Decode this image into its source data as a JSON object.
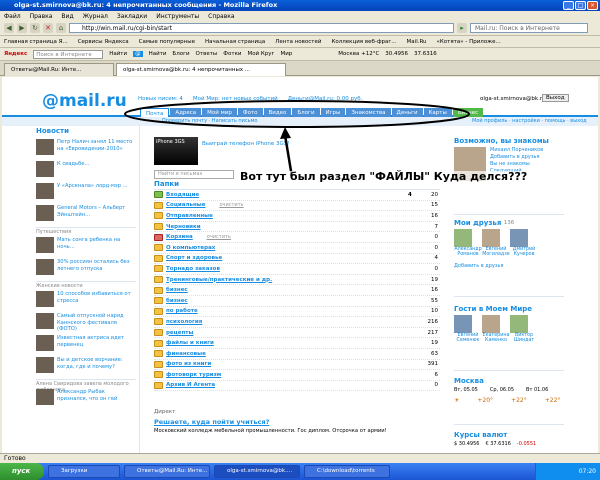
{
  "window": {
    "title": "olga-st.smirnova@bk.ru: 4 непрочитанных сообщения - Mozilla Firefox"
  },
  "menu": [
    "Файл",
    "Правка",
    "Вид",
    "Журнал",
    "Закладки",
    "Инструменты",
    "Справка"
  ],
  "address": {
    "url": "http://win.mail.ru/cgi-bin/start",
    "search_placeholder": "Mail.ru: Поиск в Интернете"
  },
  "bookmarks": [
    "Главная страница Я...",
    "Сервисы Яндекса",
    "Самые популярные",
    "Начальная страница",
    "Лента новостей",
    "Коллекция веб-фраг...",
    "Mail.Ru",
    "«Котята» - Приложе..."
  ],
  "yandex_bar": {
    "search_placeholder": "Поиск в Интернете",
    "find": "Найти",
    "items": [
      "Блоги",
      "Ответы",
      "Знакомства",
      "Афиша",
      "Авто"
    ],
    "info": "Москва +13",
    "usd": "USD 30,58",
    "eur": "EUR 43,57"
  },
  "mailru_bar": {
    "find": "Найти",
    "items": [
      "Блоги",
      "Ответы",
      "Фотки",
      "Мой Круг",
      "Мир"
    ],
    "weather": "Москва +12°С",
    "rate1": "30.4956",
    "rate2": "37.6316"
  },
  "tabs": [
    "Ответы@Mail.Ru: Инте...",
    "olga-st.smirnova@bk.ru: 4 непрочитанных ..."
  ],
  "page": {
    "logo": "@mail.ru",
    "top_links": [
      "Новых писем: 4",
      "Мой Мир: нет новых событий",
      "Деньги@Mail.ru: 0.00 руб."
    ],
    "user_email": "olga-st.smirnova@bk.ru",
    "exit": "Выход",
    "portal_tabs": [
      "Почта",
      "Адреса",
      "Мой мир",
      "Фото",
      "Видео",
      "Блоги",
      "Игры",
      "Знакомства",
      "Деньги",
      "Карты",
      "Бизнес"
    ],
    "subbar": "Проверить почту · Написать письмо",
    "settings": "Мой профиль · настройки · помощь · выход",
    "news_title": "Новости",
    "news": [
      "Петр Налич занял 11 место на «Евровидении-2010»",
      "К свадьбе...",
      "У «Арсенала» лорд-мэр ...",
      "General Motors – Альберт Эйнштейн...",
      "Путешествия",
      "Мать сонга ребенка на ночь...",
      "30% россиян остались без летнего отпуска",
      "Женские новости",
      "10 способов избавиться от стресса",
      "Самый отпускной наряд Каннского фестиваля (ФОТО)",
      "Известная актриса идет первенец",
      "Вы и детское ворчание: когда, где и почему?",
      "Алена Свиридова завела молодого любовника",
      "Александр Рыбак признался, что он гей"
    ],
    "promo": "Выиграй телефон iPhone 3GS!",
    "search_placeholder": "Найти в письмах",
    "folders_title": "Папки",
    "folders": [
      {
        "name": "Входящие",
        "unread": "4",
        "total": "20",
        "kind": "inbox"
      },
      {
        "name": "Социальные",
        "unread": "",
        "total": "15",
        "kind": "folder",
        "clear": "очистить"
      },
      {
        "name": "Отправленные",
        "unread": "",
        "total": "16",
        "kind": "folder"
      },
      {
        "name": "Черновики",
        "unread": "",
        "total": "7",
        "kind": "folder"
      },
      {
        "name": "Корзина",
        "unread": "",
        "total": "0",
        "kind": "trash",
        "clear": "очистить"
      },
      {
        "name": "О компьютерах",
        "unread": "",
        "total": "0",
        "kind": "folder"
      },
      {
        "name": "Спорт и здоровье",
        "unread": "",
        "total": "4",
        "kind": "folder"
      },
      {
        "name": "Торнадо заказов",
        "unread": "",
        "total": "0",
        "kind": "folder"
      },
      {
        "name": "Тренинговые/практические и др.",
        "unread": "",
        "total": "19",
        "kind": "folder"
      },
      {
        "name": "бизнес",
        "unread": "",
        "total": "16",
        "kind": "folder"
      },
      {
        "name": "бизнес",
        "unread": "",
        "total": "55",
        "kind": "folder"
      },
      {
        "name": "по работе",
        "unread": "",
        "total": "10",
        "kind": "folder"
      },
      {
        "name": "психология",
        "unread": "",
        "total": "216",
        "kind": "folder"
      },
      {
        "name": "рецепты",
        "unread": "",
        "total": "217",
        "kind": "folder"
      },
      {
        "name": "файлы и книги",
        "unread": "",
        "total": "19",
        "kind": "folder"
      },
      {
        "name": "финансовые",
        "unread": "",
        "total": "63",
        "kind": "folder"
      },
      {
        "name": "фото из книги",
        "unread": "",
        "total": "391",
        "kind": "folder"
      },
      {
        "name": "фотоворк туризм",
        "unread": "",
        "total": "6",
        "kind": "folder"
      },
      {
        "name": "Архив И Агента",
        "unread": "",
        "total": "0",
        "kind": "folder"
      }
    ],
    "direct_title": "Директ",
    "direct_ad": "Решаете, куда пойти учиться?",
    "direct_text": "Московский колледж мебельной промышленности. Гос диплом. Отсрочка от армии!",
    "annotation": "Вот тут был раздел \"ФАЙЛЫ\" Куда делся???",
    "right": {
      "maybe_title": "Возможно, вы знакомы",
      "maybe_person": "Михаил Порчеников",
      "maybe_links": [
        "Добавить в друзья",
        "Вы не знакомы",
        "Следующий"
      ],
      "friends_title": "Мои друзья",
      "friends_count": "136",
      "friends_names": [
        "Александр Романов",
        "Евгений Могиладзе",
        "Дмитрий Кучеров"
      ],
      "add_friend": "Добавить в друзья",
      "guests_title": "Гости в Моем Мире",
      "guests_names": [
        "Евгений Семенюк",
        "Екатерина Каменко",
        "Виктор Шиндат"
      ],
      "weather_title": "Москва",
      "weather_days": [
        "Вт, 05.05",
        "Ср, 06.05",
        "Вт 01.06"
      ],
      "weather_temps": [
        "+20°",
        "+22°",
        "+22°"
      ],
      "rates_title": "Курсы валют",
      "rates": [
        "$ 30.4956",
        "€ 37.6316",
        "-0.0551"
      ]
    }
  },
  "status": "Готово",
  "taskbar": {
    "start": "пуск",
    "items": [
      "Загрузки",
      "Ответы@Mail.Ru: Инте...",
      "olga-st.smirnova@bk....",
      "C:\\download\\torrents"
    ],
    "time": "07:20"
  }
}
